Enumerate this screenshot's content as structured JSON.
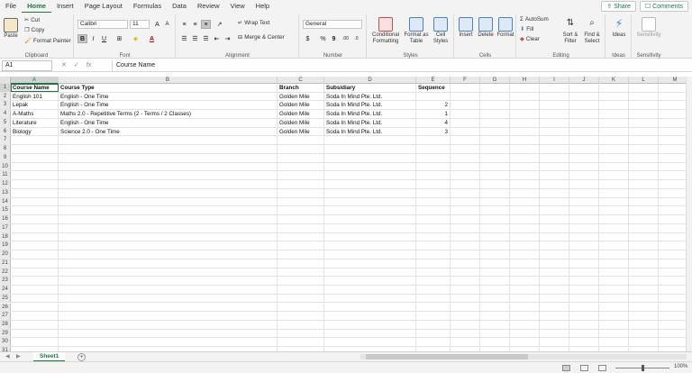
{
  "menu": {
    "tabs": [
      "File",
      "Home",
      "Insert",
      "Page Layout",
      "Formulas",
      "Data",
      "Review",
      "View",
      "Help"
    ],
    "active": "Home",
    "share": "Share",
    "comments": "Comments"
  },
  "ribbon": {
    "clipboard": {
      "paste": "Paste",
      "cut": "Cut",
      "copy": "Copy",
      "format_painter": "Format Painter",
      "label": "Clipboard"
    },
    "font": {
      "font_name": "Calibri",
      "font_size": "11",
      "grow": "A",
      "shrink": "A",
      "bold": "B",
      "italic": "I",
      "underline": "U",
      "label": "Font"
    },
    "alignment": {
      "wrap_text": "Wrap Text",
      "merge_center": "Merge & Center",
      "label": "Alignment"
    },
    "number": {
      "format": "General",
      "currency": "$",
      "percent": "%",
      "comma": "9",
      "label": "Number"
    },
    "styles": {
      "conditional": "Conditional Formatting",
      "format_table": "Format as Table",
      "cell_styles": "Cell Styles",
      "label": "Styles"
    },
    "cells": {
      "insert": "Insert",
      "delete": "Delete",
      "format": "Format",
      "label": "Cells"
    },
    "editing": {
      "autosum": "AutoSum",
      "fill": "Fill",
      "clear": "Clear",
      "sort_filter": "Sort & Filter",
      "find_select": "Find & Select",
      "label": "Editing"
    },
    "ideas": {
      "ideas": "Ideas",
      "label": "Ideas"
    },
    "sensitivity": {
      "sensitivity": "Sensitivity",
      "label": "Sensitivity"
    }
  },
  "formula_bar": {
    "name_box": "A1",
    "fx": "fx",
    "content": "Course Name"
  },
  "columns": [
    "A",
    "B",
    "C",
    "D",
    "E",
    "F",
    "G",
    "H",
    "I",
    "J",
    "K",
    "L",
    "M"
  ],
  "rows_count": 31,
  "sheet": {
    "header": [
      "Course Name",
      "Course Type",
      "Branch",
      "Subsidiary",
      "Sequence"
    ],
    "rows": [
      [
        "English 101",
        "English - One Time",
        "Golden Mile",
        "Soda In Mind Pte. Ltd.",
        ""
      ],
      [
        "Lepak",
        "English - One Time",
        "Golden Mile",
        "Soda In Mind Pte. Ltd.",
        "2"
      ],
      [
        "A-Maths",
        "Maths 2.0 - Repetitive Terms (2 - Terms / 2 Classes)",
        "Golden Mile",
        "Soda In Mind Pte. Ltd.",
        "1"
      ],
      [
        "Literature",
        "English - One Time",
        "Golden Mile",
        "Soda In Mind Pte. Ltd.",
        "4"
      ],
      [
        "Biology",
        "Science 2.0 - One Time",
        "Golden Mile",
        "Soda In Mind Pte. Ltd.",
        "3"
      ]
    ]
  },
  "sheet_tabs": {
    "active": "Sheet1",
    "add": "+"
  },
  "status": {
    "zoom": "100%"
  },
  "colors": {
    "accent": "#217346"
  }
}
